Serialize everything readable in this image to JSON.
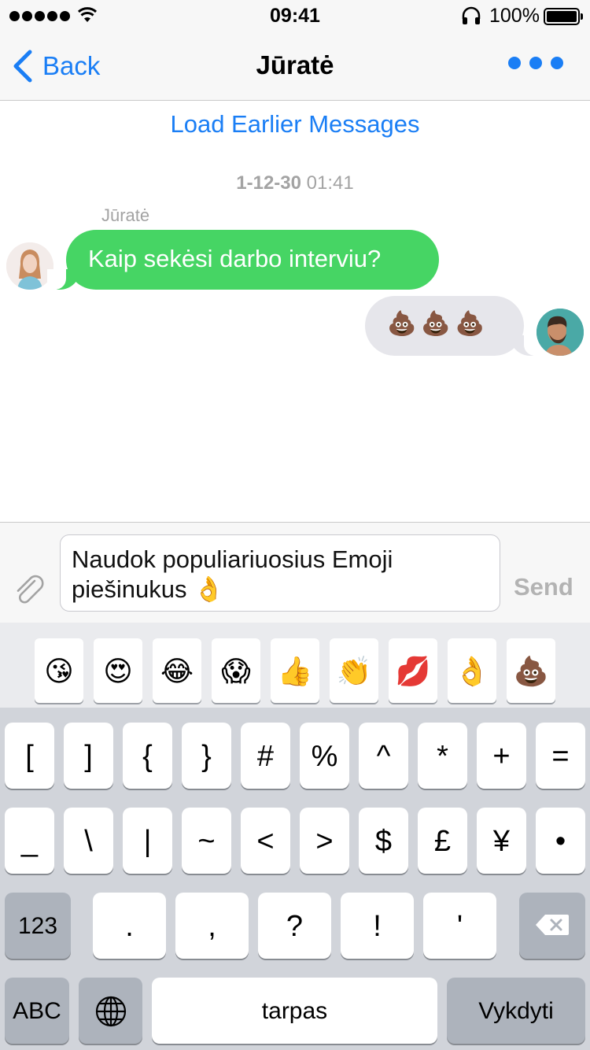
{
  "status_bar": {
    "time": "09:41",
    "battery_percent": "100%",
    "signal_bars": 5,
    "icons": [
      "signal-dots-icon",
      "wifi-icon",
      "headphones-icon",
      "battery-icon"
    ]
  },
  "nav": {
    "back_label": "Back",
    "title": "Jūratė",
    "more_icon": "more-dots-icon",
    "accent_color": "#1a7ef5"
  },
  "chat": {
    "load_earlier": "Load Earlier Messages",
    "timestamp_date": "1-12-30",
    "timestamp_time": "01:41",
    "messages": [
      {
        "sender": "Jūratė",
        "text": "Kaip sekėsi darbo interviu?",
        "direction": "incoming",
        "bubble_color": "#46d564"
      },
      {
        "sender": "",
        "text": "💩💩💩",
        "direction": "outgoing",
        "bubble_color": "#e6e6eb"
      }
    ]
  },
  "input": {
    "value": "Naudok populiariuosius Emoji piešinukus 👌",
    "send_label": "Send",
    "attach_icon": "paperclip-icon"
  },
  "keyboard": {
    "emoji_suggestions": [
      "😘",
      "😍",
      "😂",
      "😱",
      "👍",
      "👏",
      "💋",
      "👌",
      "💩"
    ],
    "row1": [
      "[",
      "]",
      "{",
      "}",
      "#",
      "%",
      "^",
      "*",
      "+",
      "="
    ],
    "row2": [
      "_",
      "\\",
      "|",
      "~",
      "<",
      ">",
      "$",
      "£",
      "¥",
      "•"
    ],
    "row3_mode": "123",
    "row3": [
      ".",
      ",",
      "?",
      "!",
      "'"
    ],
    "abc_label": "ABC",
    "space_label": "tarpas",
    "return_label": "Vykdyti"
  }
}
